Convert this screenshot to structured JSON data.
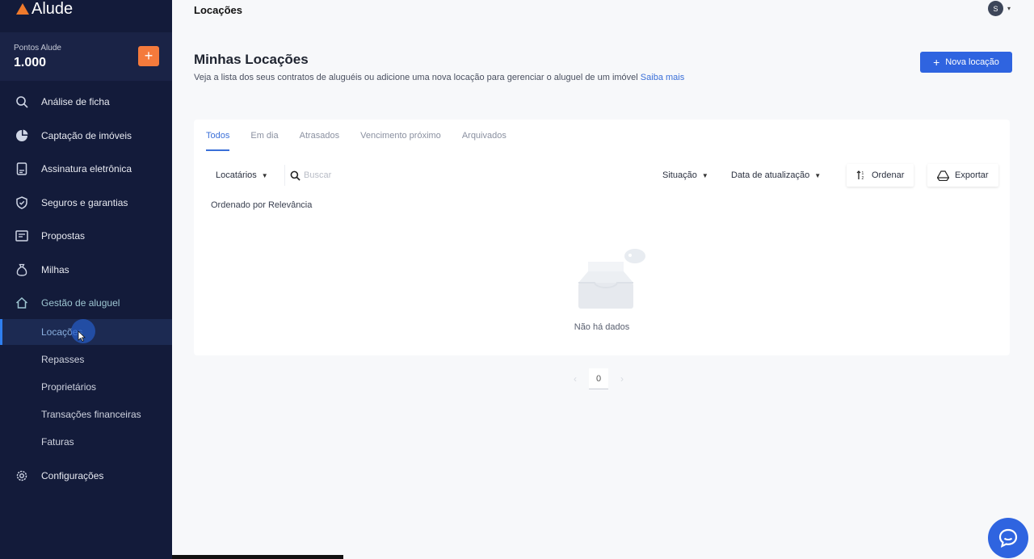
{
  "app": {
    "brand": "Alude"
  },
  "sidebar": {
    "points_label": "Pontos Alude",
    "points_value": "1.000",
    "add_symbol": "+",
    "items": [
      {
        "label": "Análise de ficha",
        "icon": "search-icon"
      },
      {
        "label": "Captação de imóveis",
        "icon": "pie-chart-icon"
      },
      {
        "label": "Assinatura eletrônica",
        "icon": "document-sign-icon"
      },
      {
        "label": "Seguros e garantias",
        "icon": "shield-icon"
      },
      {
        "label": "Propostas",
        "icon": "proposal-icon"
      },
      {
        "label": "Milhas",
        "icon": "money-bag-icon"
      },
      {
        "label": "Gestão de aluguel",
        "icon": "home-icon"
      },
      {
        "label": "Configurações",
        "icon": "gear-icon"
      }
    ],
    "sub_items": [
      {
        "label": "Locações",
        "active": true
      },
      {
        "label": "Repasses"
      },
      {
        "label": "Proprietários"
      },
      {
        "label": "Transações financeiras"
      },
      {
        "label": "Faturas"
      }
    ]
  },
  "topbar": {
    "title": "Locações",
    "avatar_initial": "S"
  },
  "header": {
    "title": "Minhas Locações",
    "description": "Veja a lista dos seus contratos de aluguéis ou adicione uma nova locação para gerenciar o aluguel de um imóvel",
    "learn_more": "Saiba mais",
    "new_button": "Nova locação"
  },
  "tabs": [
    {
      "label": "Todos",
      "active": true
    },
    {
      "label": "Em dia"
    },
    {
      "label": "Atrasados"
    },
    {
      "label": "Vencimento próximo"
    },
    {
      "label": "Arquivados"
    }
  ],
  "filters": {
    "tenants_dropdown": "Locatários",
    "search_placeholder": "Buscar",
    "status_dropdown": "Situação",
    "updated_dropdown": "Data de atualização",
    "sort_button": "Ordenar",
    "export_button": "Exportar"
  },
  "ordering": {
    "label": "Ordenado por",
    "value": "Relevância"
  },
  "empty_state": {
    "text": "Não há dados"
  },
  "pagination": {
    "current_page": "0"
  },
  "colors": {
    "sidebar_bg": "#131b3a",
    "accent": "#2f64e0",
    "orange": "#f47a3c"
  }
}
